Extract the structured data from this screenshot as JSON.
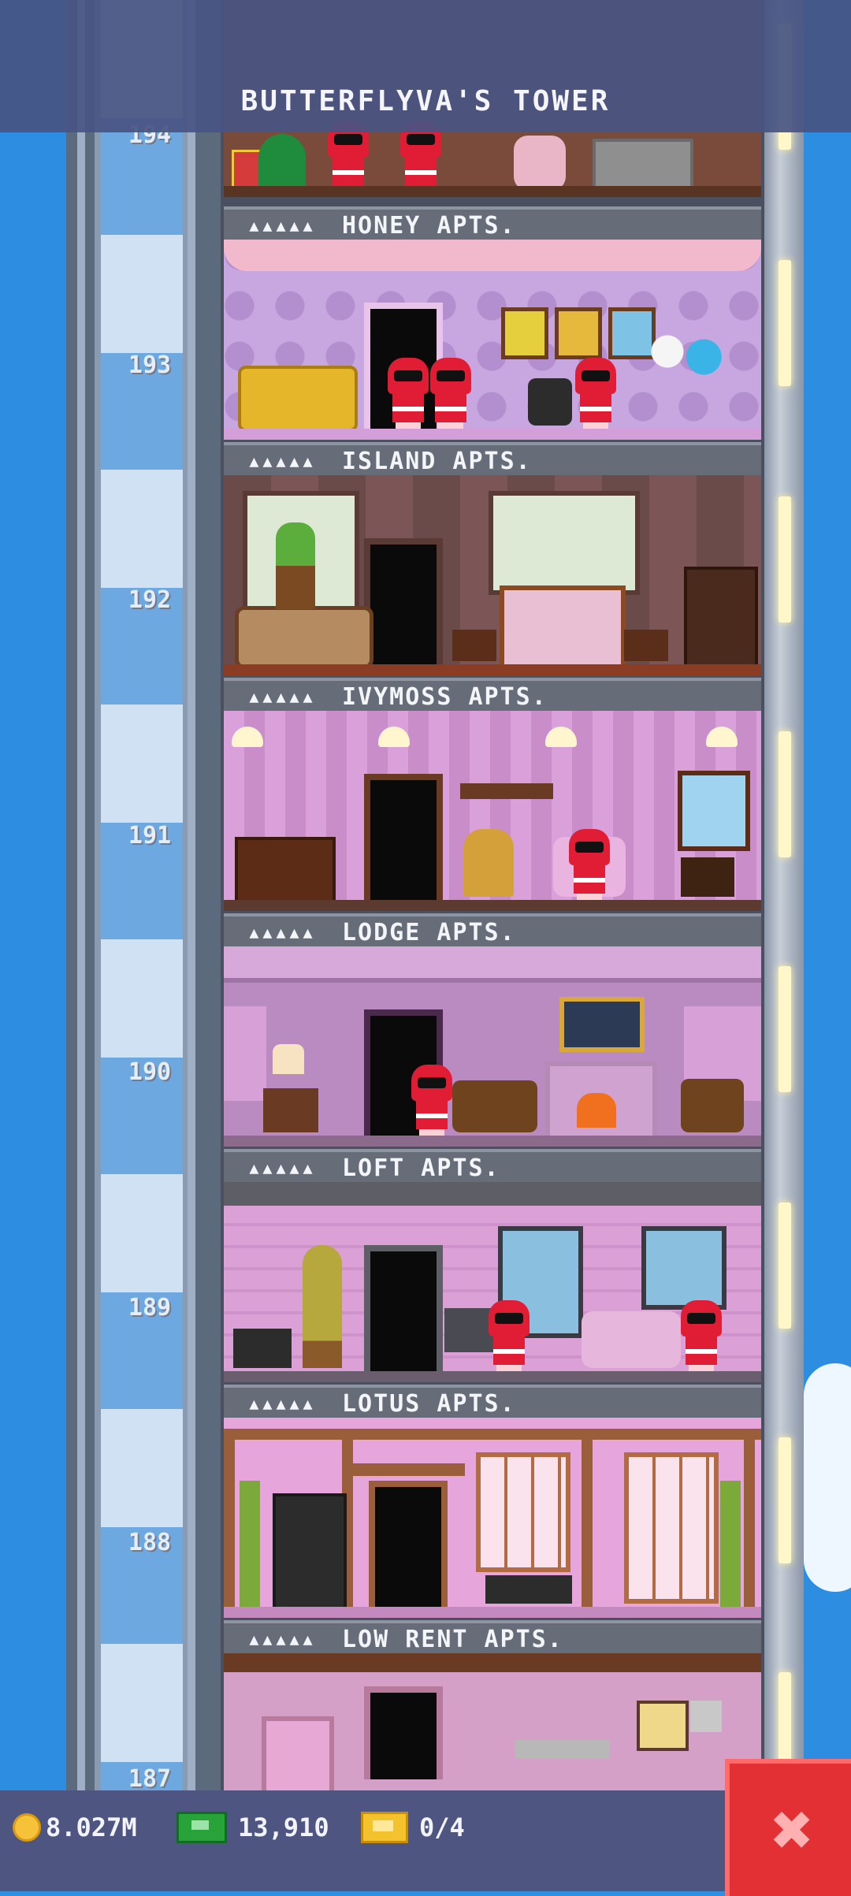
{
  "header": {
    "title": "BUTTERFLYVA'S TOWER"
  },
  "floors": [
    {
      "number": "194",
      "label": "HONEY APTS."
    },
    {
      "number": "193",
      "label": "ISLAND APTS."
    },
    {
      "number": "192",
      "label": "IVYMOSS APTS."
    },
    {
      "number": "191",
      "label": "LODGE APTS."
    },
    {
      "number": "190",
      "label": "LOFT APTS."
    },
    {
      "number": "189",
      "label": "LOTUS APTS."
    },
    {
      "number": "188",
      "label": "LOW RENT APTS."
    },
    {
      "number": "187",
      "label": ""
    }
  ],
  "label_icon": "resident-slots-icon",
  "footer": {
    "coins": "8.027M",
    "bux": "13,910",
    "tickets": "0/4",
    "close_icon": "close-icon"
  },
  "colors": {
    "sky": "#2d8de0",
    "header": "#485482",
    "close_button": "#e23035",
    "character": "#e11d35"
  }
}
